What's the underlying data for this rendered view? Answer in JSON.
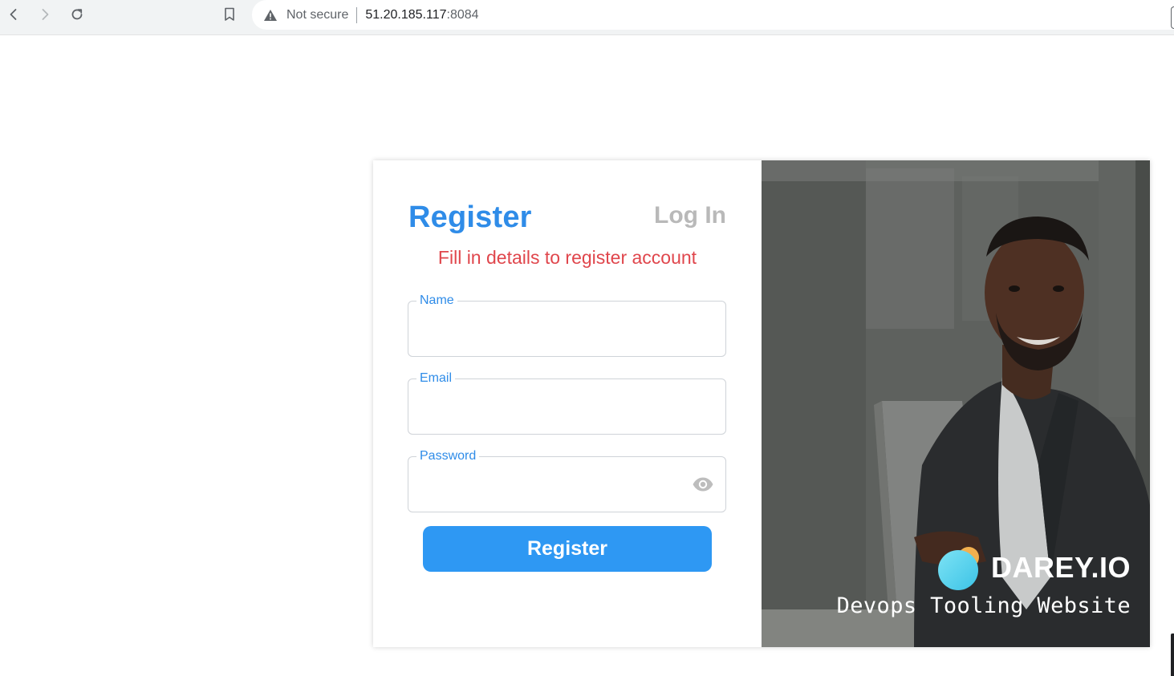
{
  "browser": {
    "security_status": "Not secure",
    "url_host": "51.20.185.117",
    "url_port": ":8084"
  },
  "form": {
    "tab_active": "Register",
    "tab_inactive": "Log In",
    "subtitle": "Fill in details to register account",
    "fields": [
      {
        "label": "Name",
        "value": ""
      },
      {
        "label": "Email",
        "value": ""
      },
      {
        "label": "Password",
        "value": ""
      }
    ],
    "submit_label": "Register"
  },
  "brand": {
    "logo_text": "DAREY.IO",
    "tagline": "Devops Tooling Website"
  },
  "colors": {
    "accent_blue": "#2f8ce8",
    "button_blue": "#2e98f3",
    "subtitle_red": "#e0464c",
    "inactive_tab_gray": "#b9b9b9"
  },
  "icons": [
    "back-arrow-icon",
    "forward-arrow-icon",
    "reload-icon",
    "bookmark-icon",
    "warning-icon",
    "eye-icon"
  ]
}
